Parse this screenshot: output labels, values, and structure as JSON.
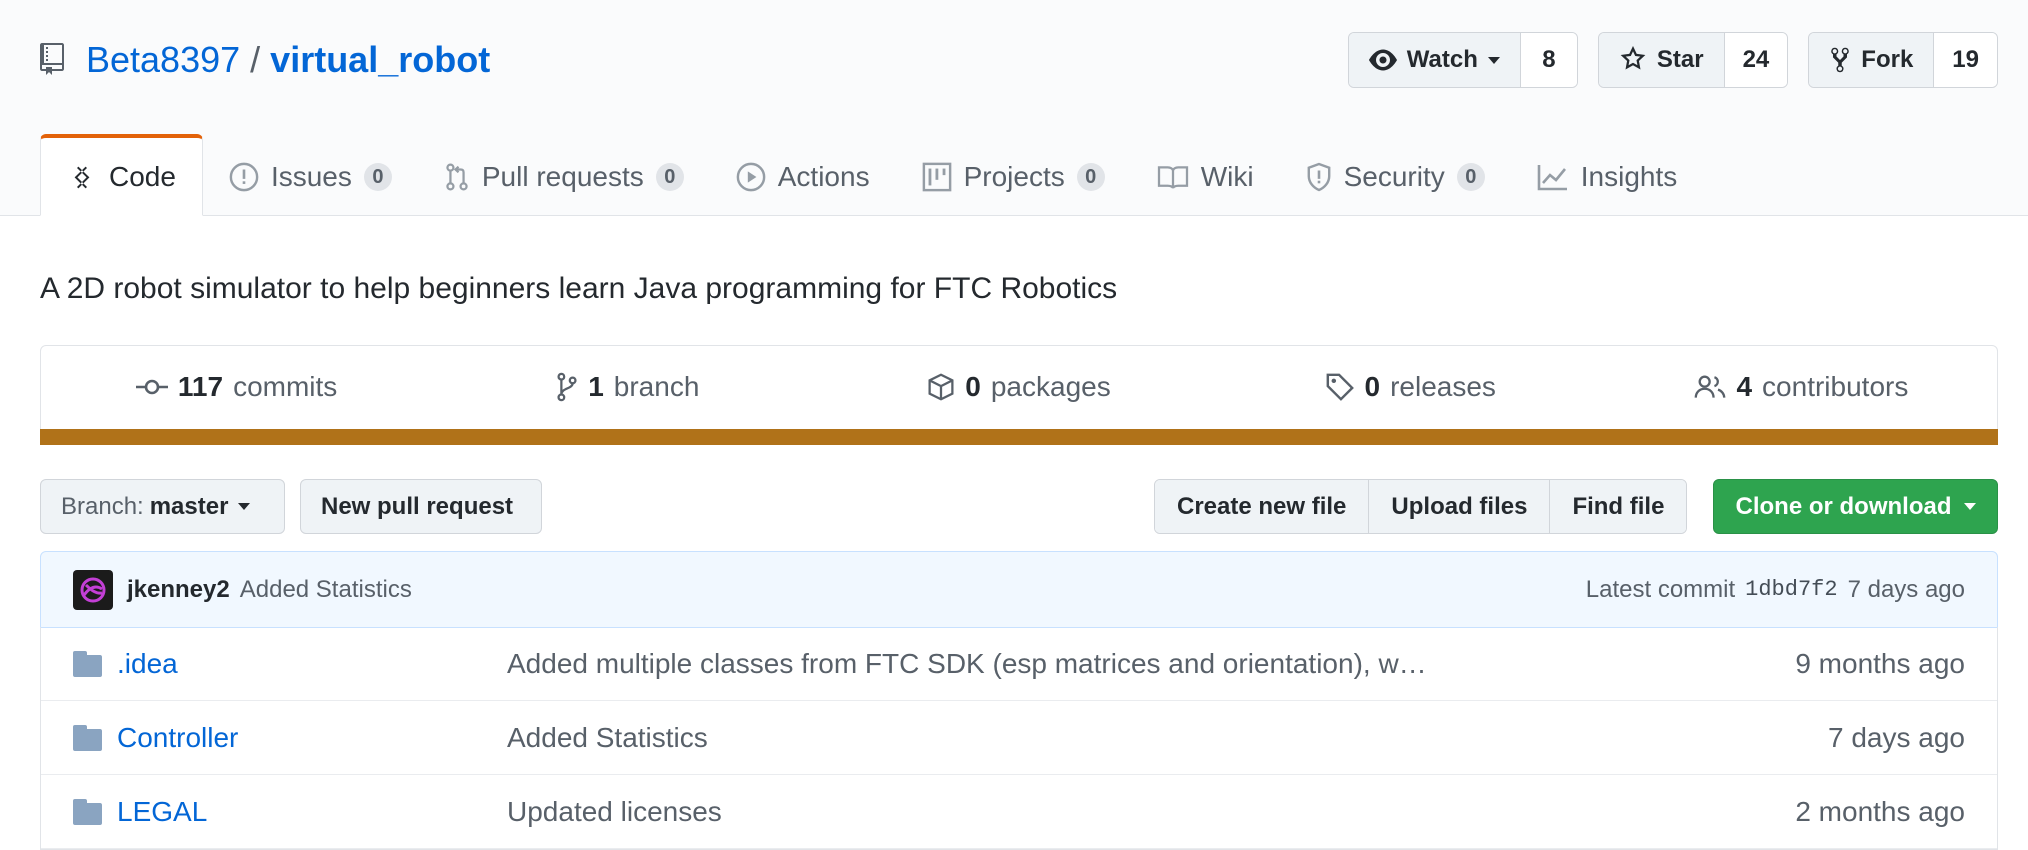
{
  "repo": {
    "owner": "Beta8397",
    "separator": "/",
    "name": "virtual_robot",
    "description": "A 2D robot simulator to help beginners learn Java programming for FTC Robotics"
  },
  "actions": {
    "watch": {
      "label": "Watch",
      "count": "8"
    },
    "star": {
      "label": "Star",
      "count": "24"
    },
    "fork": {
      "label": "Fork",
      "count": "19"
    }
  },
  "tabs": [
    {
      "label": "Code",
      "icon": "code-icon"
    },
    {
      "label": "Issues",
      "count": "0",
      "icon": "issue-opened-icon"
    },
    {
      "label": "Pull requests",
      "count": "0",
      "icon": "git-pull-request-icon"
    },
    {
      "label": "Actions",
      "icon": "play-icon"
    },
    {
      "label": "Projects",
      "count": "0",
      "icon": "project-icon"
    },
    {
      "label": "Wiki",
      "icon": "book-icon"
    },
    {
      "label": "Security",
      "count": "0",
      "icon": "shield-icon"
    },
    {
      "label": "Insights",
      "icon": "graph-icon"
    }
  ],
  "summary": {
    "commits": {
      "num": "117",
      "label": "commits"
    },
    "branches": {
      "num": "1",
      "label": "branch"
    },
    "packages": {
      "num": "0",
      "label": "packages"
    },
    "releases": {
      "num": "0",
      "label": "releases"
    },
    "contributors": {
      "num": "4",
      "label": "contributors"
    },
    "language_color": "#b07219"
  },
  "file_nav": {
    "branch_prefix": "Branch:",
    "branch_name": "master",
    "new_pr": "New pull request",
    "create_file": "Create new file",
    "upload_files": "Upload files",
    "find_file": "Find file",
    "clone": "Clone or download"
  },
  "latest_commit": {
    "author": "jkenney2",
    "message": "Added Statistics",
    "prefix": "Latest commit",
    "sha": "1dbd7f2",
    "age": "7 days ago"
  },
  "files": [
    {
      "name": ".idea",
      "message": "Added multiple classes from FTC SDK (esp matrices and orientation), w…",
      "age": "9 months ago"
    },
    {
      "name": "Controller",
      "message": "Added Statistics",
      "age": "7 days ago"
    },
    {
      "name": "LEGAL",
      "message": "Updated licenses",
      "age": "2 months ago"
    }
  ]
}
